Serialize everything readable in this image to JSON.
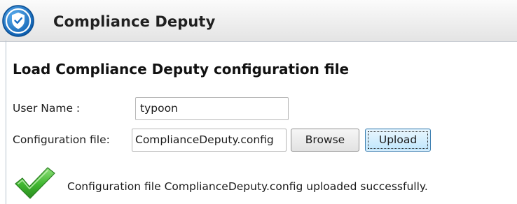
{
  "app": {
    "title": "Compliance Deputy",
    "logo_icon": "shield-check-icon"
  },
  "page": {
    "heading": "Load Compliance Deputy configuration file"
  },
  "form": {
    "user_name_label": "User Name :",
    "user_name_value": "typoon",
    "config_file_label": "Configuration file:",
    "config_file_value": "ComplianceDeputy.config",
    "browse_label": "Browse",
    "upload_label": "Upload"
  },
  "status": {
    "icon": "checkmark-icon",
    "message": "Configuration file ComplianceDeputy.config uploaded successfully."
  },
  "colors": {
    "logo_blue": "#1a6fc4",
    "success_green": "#3fb62f",
    "upload_border": "#3c7fb1"
  }
}
